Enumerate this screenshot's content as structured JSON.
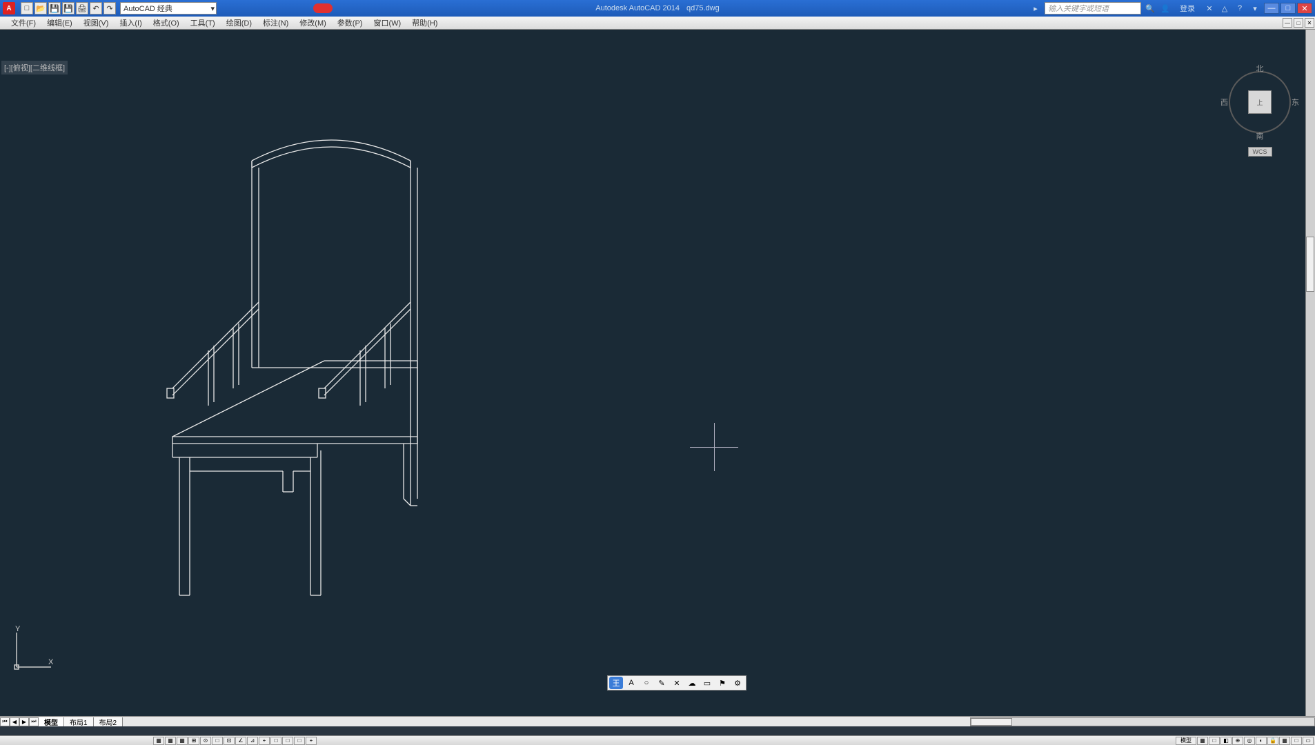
{
  "title": {
    "app": "Autodesk AutoCAD 2014",
    "file": "qd75.dwg"
  },
  "app_icon_letter": "A",
  "workspace": "AutoCAD 经典",
  "search_placeholder": "输入关键字或短语",
  "login_label": "登录",
  "menus": [
    "文件(F)",
    "编辑(E)",
    "视图(V)",
    "插入(I)",
    "格式(O)",
    "工具(T)",
    "绘图(D)",
    "标注(N)",
    "修改(M)",
    "参数(P)",
    "窗口(W)",
    "帮助(H)"
  ],
  "viewport_tag": "[-][俯视][二维线框]",
  "viewcube": {
    "n": "北",
    "s": "南",
    "e": "东",
    "w": "西",
    "face": "上",
    "wcs": "WCS"
  },
  "ucs": {
    "x": "X",
    "y": "Y"
  },
  "layout_tabs": {
    "model": "模型",
    "l1": "布局1",
    "l2": "布局2"
  },
  "layout_nav": [
    "⏮",
    "◀",
    "▶",
    "⏭"
  ],
  "cmdline_text": "",
  "qat_icons": [
    "new",
    "open",
    "save",
    "saveas",
    "print",
    "undo",
    "redo"
  ],
  "title_right_icons": [
    "exchange",
    "signin",
    "divider",
    "xref",
    "cloud",
    "help",
    "dd"
  ],
  "float_icons": [
    "王",
    "A",
    "○",
    "✎",
    "✕",
    "☁",
    "▭",
    "⚑",
    "⚙"
  ],
  "status_btns_left": [
    "▦",
    "▦",
    "▦",
    "⊞",
    "⊙",
    "□",
    "⊡",
    "∠",
    "⊿",
    "+",
    "□",
    "□",
    "□",
    "+"
  ],
  "status_btns_right": [
    "模型",
    "▦",
    "□",
    "◧",
    "⊕",
    "◎",
    "◐",
    "人",
    "▦",
    "□"
  ],
  "win_btns": {
    "min": "—",
    "max": "□",
    "close": "✕"
  },
  "mb_btns": {
    "min": "—",
    "max": "□",
    "close": "✕"
  }
}
